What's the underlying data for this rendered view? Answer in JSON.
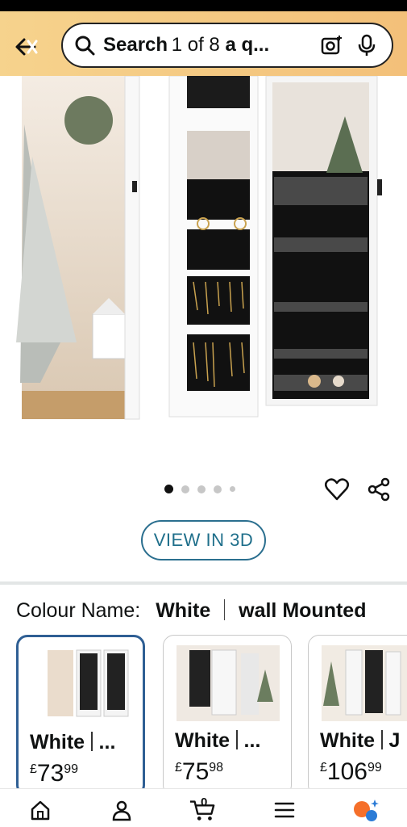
{
  "header": {
    "search_text": "Search",
    "search_overlay_text": "1 of 8",
    "search_tail": "a q..."
  },
  "gallery": {
    "image_count": 5,
    "active_index": 0
  },
  "actions": {
    "view3d_label": "VIEW IN 3D"
  },
  "variation": {
    "label": "Colour Name:",
    "value_color": "White",
    "value_style": "wall Mounted"
  },
  "swatches": [
    {
      "name": "White",
      "ellipsis": "...",
      "currency": "£",
      "whole": "73",
      "fraction": "99"
    },
    {
      "name": "White",
      "ellipsis": "...",
      "currency": "£",
      "whole": "75",
      "fraction": "98"
    },
    {
      "name": "White",
      "ellipsis": "J",
      "currency": "£",
      "whole": "106",
      "fraction": "99"
    }
  ],
  "nav": {
    "cart_count": "0",
    "items": [
      "home-icon",
      "account-icon",
      "cart-icon",
      "menu-icon",
      "assistant-icon"
    ]
  },
  "colors": {
    "header_gradient_start": "#f6d38d",
    "header_gradient_end": "#f3c079",
    "accent": "#2b6f8f",
    "selected_border": "#2f5f94"
  }
}
